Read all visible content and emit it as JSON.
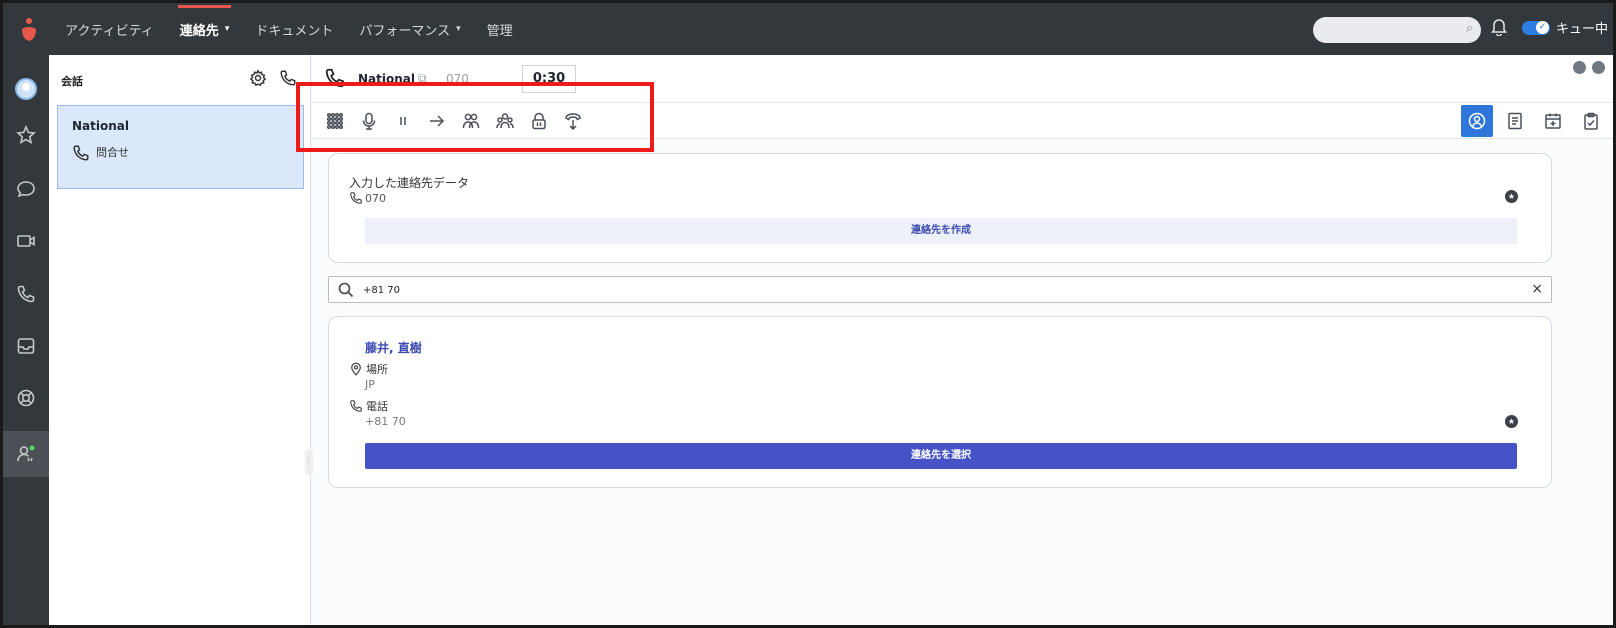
{
  "topnav": {
    "items": [
      {
        "label": "アクティビティ",
        "has_caret": false
      },
      {
        "label": "連絡先",
        "has_caret": true
      },
      {
        "label": "ドキュメント",
        "has_caret": false
      },
      {
        "label": "パフォーマンス",
        "has_caret": true
      },
      {
        "label": "管理",
        "has_caret": false
      }
    ],
    "search_placeholder": "",
    "queue_label": "キュー中",
    "caret": "▾",
    "bell_icon": "bell-icon"
  },
  "colors": {
    "topbar": "#33383d",
    "accent": "#2f76db",
    "highlight": "#ee1b1b",
    "brand": "#e8574c",
    "primary_button": "#4553c6"
  },
  "rail": {
    "icons": [
      "avatar",
      "star-icon",
      "chat-icon",
      "video-icon",
      "phone-icon",
      "inbox-icon",
      "lifebuoy-icon",
      "agent-status-icon"
    ]
  },
  "conversations": {
    "title": "会話",
    "items": [
      {
        "name": "National",
        "type": "問合せ"
      }
    ]
  },
  "call": {
    "name": "National",
    "number": "070",
    "timer": "0:30"
  },
  "toolbar": {
    "left": [
      "dialpad-icon",
      "mic-icon",
      "hold-icon",
      "transfer-icon",
      "consult-icon",
      "conference-icon",
      "secure-pause-icon",
      "wrapup-icon"
    ],
    "right": [
      "contact-icon",
      "notes-icon",
      "schedule-icon",
      "clipboard-icon"
    ]
  },
  "entered_contact": {
    "title": "入力した連絡先データ",
    "number": "070",
    "create_button": "連絡先を作成"
  },
  "search": {
    "value": "+81 70",
    "clear": "×"
  },
  "result": {
    "name": "藤井, 直樹",
    "location_label": "場所",
    "location_value": "JP",
    "phone_label": "電話",
    "phone_value": "+81 70",
    "select_button": "連絡先を選択"
  }
}
